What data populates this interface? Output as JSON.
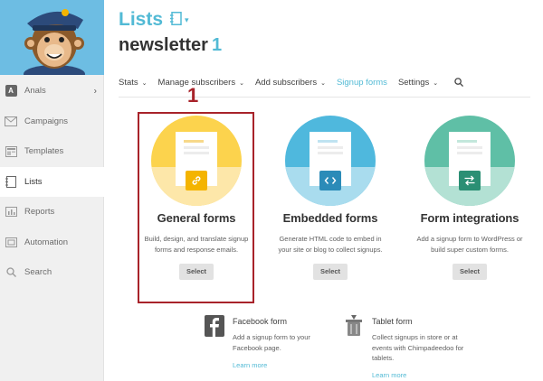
{
  "sidebar": {
    "items": [
      {
        "label": "Anals",
        "icon": "account-avatar-icon",
        "avatar_letter": "A",
        "chevron": "›"
      },
      {
        "label": "Campaigns",
        "icon": "envelope-icon"
      },
      {
        "label": "Templates",
        "icon": "template-icon"
      },
      {
        "label": "Lists",
        "icon": "list-icon",
        "active": true
      },
      {
        "label": "Reports",
        "icon": "bar-chart-icon"
      },
      {
        "label": "Automation",
        "icon": "automation-icon"
      },
      {
        "label": "Search",
        "icon": "search-icon"
      }
    ]
  },
  "header": {
    "title": "Lists",
    "list_name": "newsletter",
    "count": "1"
  },
  "tabs": [
    {
      "label": "Stats",
      "caret": "⌄",
      "active": false
    },
    {
      "label": "Manage subscribers",
      "caret": "⌄",
      "active": false
    },
    {
      "label": "Add subscribers",
      "caret": "⌄",
      "active": false
    },
    {
      "label": "Signup forms",
      "active": true
    },
    {
      "label": "Settings",
      "caret": "⌄",
      "active": false
    }
  ],
  "annotation": {
    "number": "1"
  },
  "cards": [
    {
      "title": "General forms",
      "description": "Build, design, and translate signup forms and response emails.",
      "button": "Select",
      "color_top": "#fcd34d",
      "color_bottom": "#fde7a9",
      "badge_color": "#f4b400",
      "icon": "link-icon",
      "glyph": "🔗"
    },
    {
      "title": "Embedded forms",
      "description": "Generate HTML code to embed in your site or blog to collect signups.",
      "button": "Select",
      "color_top": "#4fb8dd",
      "color_bottom": "#a9dcee",
      "badge_color": "#2b8bb8",
      "icon": "code-icon",
      "glyph": "<>"
    },
    {
      "title": "Form integrations",
      "description": "Add a signup form to WordPress or build super custom forms.",
      "button": "Select",
      "color_top": "#5fbfa6",
      "color_bottom": "#b3e1d4",
      "badge_color": "#2b8f74",
      "icon": "swap-arrows-icon",
      "glyph": "⇆"
    }
  ],
  "extras": [
    {
      "title": "Facebook form",
      "description": "Add a signup form to your Facebook page.",
      "link": "Learn more",
      "icon": "facebook-icon"
    },
    {
      "title": "Tablet form",
      "description": "Collect signups in store or at events with Chimpadeedoo for tablets.",
      "link": "Learn more",
      "icon": "chimpadeedoo-icon"
    }
  ]
}
